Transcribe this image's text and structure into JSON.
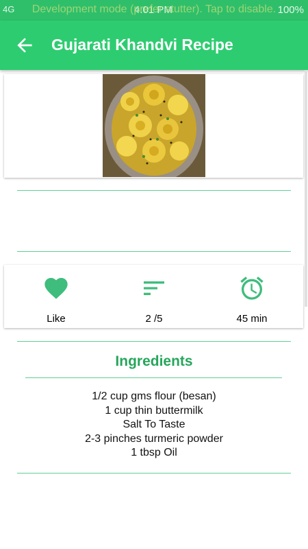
{
  "status_bar": {
    "left": "4G",
    "time": "4:01 PM",
    "battery": "100%",
    "overlay_text": "Development mode (prefer stutter). Tap to disable."
  },
  "app_bar": {
    "title": "Gujarati Khandvi Recipe",
    "back_icon": "arrow-back-icon",
    "color": "#2ecc71"
  },
  "stats": {
    "like_label": "Like",
    "rating_label": "2 /5",
    "time_label": "45 min",
    "icons": [
      "heart-icon",
      "sort-lines-icon",
      "alarm-clock-icon"
    ],
    "icon_color": "#3ebd7d"
  },
  "ingredients": {
    "title": "Ingredients",
    "items": [
      "1/2 cup gms flour (besan)",
      "1 cup thin buttermilk",
      "Salt To Taste",
      "2-3 pinches turmeric powder",
      "1 tbsp Oil"
    ]
  }
}
